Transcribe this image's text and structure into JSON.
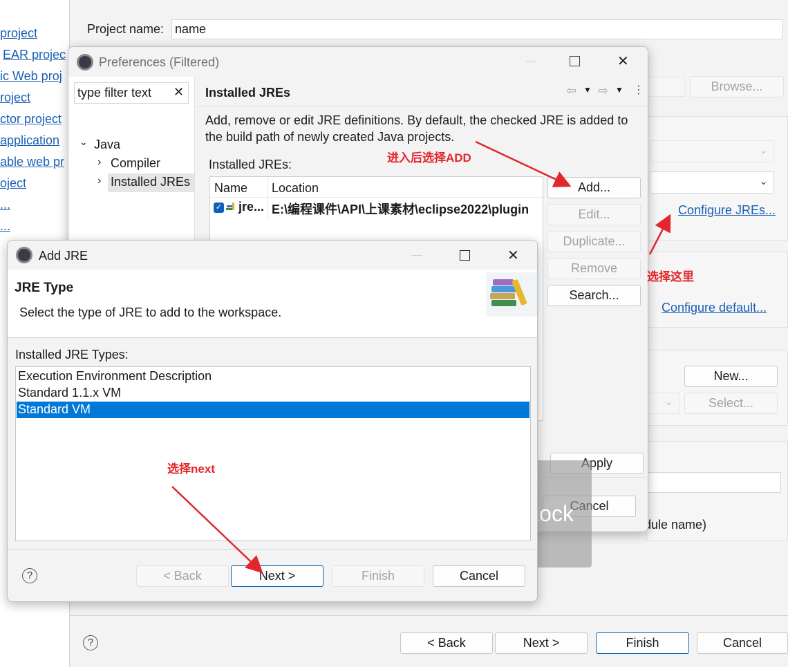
{
  "left_links": [
    "project",
    "EAR projec",
    "ic Web proj",
    "roject",
    "ctor project",
    "application",
    "able web pr",
    "oject",
    "...",
    "..."
  ],
  "wizard": {
    "project_name_label": "Project name:",
    "project_name_value": "name",
    "browse_label": "Browse...",
    "configure_jres_label": "Configure JREs...",
    "configure_default_label": "Configure default...",
    "new_label": "New...",
    "select_label": "Select...",
    "module_text": "dule name)",
    "back_label": "< Back",
    "next_label": "Next >",
    "finish_label": "Finish",
    "cancel_label": "Cancel",
    "help_symbol": "?"
  },
  "prefs": {
    "title": "Preferences (Filtered)",
    "filter_placeholder": "type filter text",
    "tree": {
      "java": "Java",
      "compiler": "Compiler",
      "installed_jres": "Installed JREs"
    },
    "page_title": "Installed JREs",
    "description": "Add, remove or edit JRE definitions. By default, the checked JRE is added to the build path of newly created Java projects.",
    "installed_label": "Installed JREs:",
    "columns": [
      "Name",
      "Location"
    ],
    "rows": [
      {
        "name": "jre...",
        "location": "E:\\编程课件\\API\\上课素材\\eclipse2022\\plugin",
        "checked": true
      }
    ],
    "buttons": {
      "add": "Add...",
      "edit": "Edit...",
      "duplicate": "Duplicate...",
      "remove": "Remove",
      "search": "Search...",
      "apply": "Apply",
      "cancel": "Cancel"
    }
  },
  "add_jre": {
    "title": "Add JRE",
    "header_title": "JRE Type",
    "header_desc": "Select the type of JRE to add to the workspace.",
    "types_label": "Installed JRE Types:",
    "types": [
      "Execution Environment Description",
      "Standard 1.1.x VM",
      "Standard VM"
    ],
    "selected_index": 2,
    "back_label": "< Back",
    "next_label": "Next >",
    "finish_label": "Finish",
    "cancel_label": "Cancel",
    "help_symbol": "?"
  },
  "annotations": {
    "add_hint": "进入后选择ADD",
    "configure_hint": "选择这里",
    "next_hint": "选择next",
    "color": "#e3262b"
  },
  "overlay_text": "FnLock",
  "colors": {
    "link": "#1a5fb4",
    "selection": "#0078d7",
    "default_button_border": "#0b63b5"
  }
}
